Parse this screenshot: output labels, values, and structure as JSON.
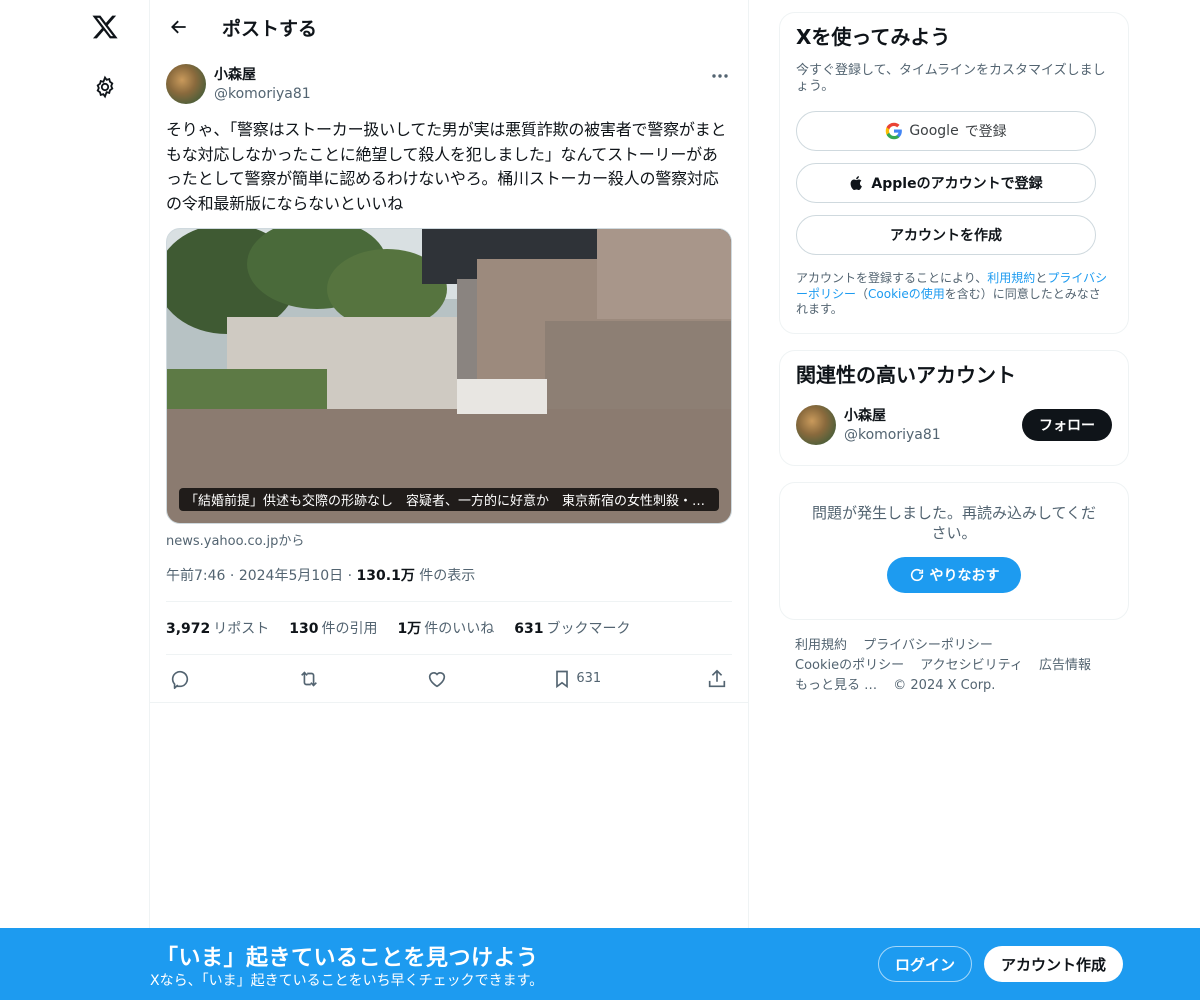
{
  "header": {
    "title": "ポストする"
  },
  "post": {
    "display_name": "小森屋",
    "handle": "@komoriya81",
    "text": "そりゃ、「警察はストーカー扱いしてた男が実は悪質詐欺の被害者で警察がまともな対応しなかったことに絶望して殺人を犯しました」なんてストーリーがあったとして警察が簡単に認めるわけないやろ。桶川ストーカー殺人の警察対応の令和最新版にならないといいね",
    "media_caption": "「結婚前提」供述も交際の形跡なし　容疑者、一方的に好意か　東京新宿の女性刺殺・警察…",
    "source": "news.yahoo.co.jpから",
    "time": "午前7:46",
    "date": "2024年5月10日",
    "views_count": "130.1万",
    "views_label": "件の表示",
    "separator": "·"
  },
  "stats": {
    "reposts_count": "3,972",
    "reposts_label": "リポスト",
    "quotes_count": "130",
    "quotes_label": "件の引用",
    "likes_count": "1万",
    "likes_label": "件のいいね",
    "bookmarks_count": "631",
    "bookmarks_label": "ブックマーク"
  },
  "actions": {
    "bookmark_count": "631"
  },
  "signup_card": {
    "title": "Xを使ってみよう",
    "subtitle": "今すぐ登録して、タイムラインをカスタマイズしましょう。",
    "google_label": "Google",
    "google_suffix": "で登録",
    "apple_label": "Appleのアカウントで登録",
    "create_label": "アカウントを作成",
    "terms_pre": "アカウントを登録することにより、",
    "terms_link1": "利用規約",
    "terms_and": "と",
    "terms_link2": "プライバシーポリシー",
    "terms_paren_open": "（",
    "terms_link3": "Cookieの使用",
    "terms_post": "を含む）に同意したとみなされます。"
  },
  "related": {
    "title": "関連性の高いアカウント",
    "display_name": "小森屋",
    "handle": "@komoriya81",
    "follow_label": "フォロー"
  },
  "error_card": {
    "message": "問題が発生しました。再読み込みしてください。",
    "retry_label": "やりなおす"
  },
  "footer": {
    "links": [
      "利用規約",
      "プライバシーポリシー",
      "Cookieのポリシー",
      "アクセシビリティ",
      "広告情報",
      "もっと見る …"
    ],
    "copyright": "© 2024 X Corp."
  },
  "banner": {
    "title": "「いま」起きていることを見つけよう",
    "subtitle": "Xなら、「いま」起きていることをいち早くチェックできます。",
    "login_label": "ログイン",
    "signup_label": "アカウント作成"
  },
  "colors": {
    "accent": "#1d9bf0",
    "text": "#0f1419",
    "muted": "#536471"
  }
}
